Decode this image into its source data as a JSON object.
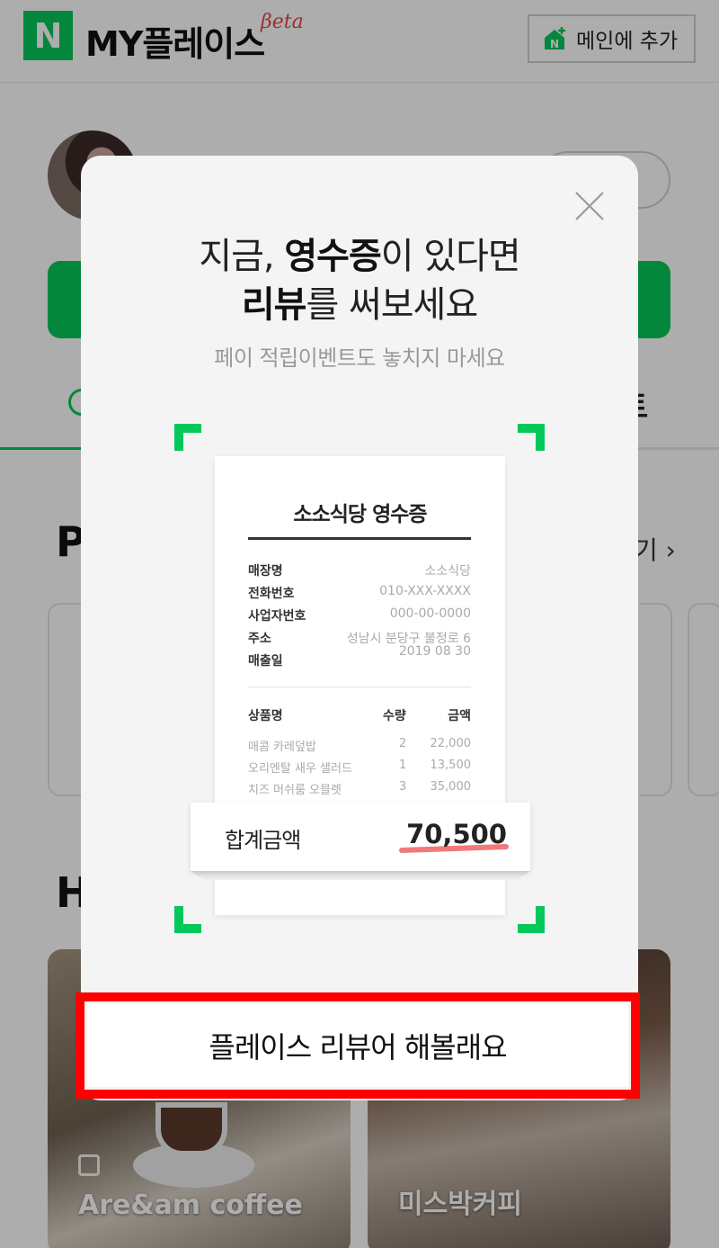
{
  "header": {
    "brand_letter": "N",
    "brand_title": "MY플레이스",
    "beta_label": "βeta",
    "add_main_label": "메인에 추가"
  },
  "background": {
    "tab_fragment": "트",
    "section_p_letter": "P",
    "section_more_label": "기 ›",
    "section_h_letter": "H",
    "place_cards": [
      {
        "name": "Are&am coffee"
      },
      {
        "name": "미스박커피"
      }
    ]
  },
  "modal": {
    "title_line1_prefix": "지금, ",
    "title_line1_bold": "영수증",
    "title_line1_suffix": "이 있다면",
    "title_line2_bold": "리뷰",
    "title_line2_suffix": "를 써보세요",
    "subtitle": "페이 적립이벤트도 놓치지 마세요",
    "receipt": {
      "title": "소소식당 영수증",
      "info": [
        {
          "key": "매장명",
          "value": "소소식당"
        },
        {
          "key": "전화번호",
          "value": "010-XXX-XXXX"
        },
        {
          "key": "사업자번호",
          "value": "000-00-0000"
        },
        {
          "key": "주소",
          "value": "성남시 분당구 불정로 6"
        },
        {
          "key": "매출일",
          "value": "2019 08 30"
        }
      ],
      "columns": {
        "name": "상품명",
        "qty": "수량",
        "amount": "금액"
      },
      "items": [
        {
          "name": "매콤 카레덮밥",
          "qty": "2",
          "amount": "22,000"
        },
        {
          "name": "오리엔탈 새우 샐러드",
          "qty": "1",
          "amount": "13,500"
        },
        {
          "name": "치즈 머쉬룸 오믈렛",
          "qty": "3",
          "amount": "35,000"
        }
      ],
      "total_label": "합계금액",
      "total_value": "70,500"
    },
    "cta_label": "플레이스 리뷰어 해볼래요"
  },
  "colors": {
    "brand_green": "#03c75a",
    "highlight_red": "#ff0000",
    "underline_pink": "#f06a6a"
  }
}
